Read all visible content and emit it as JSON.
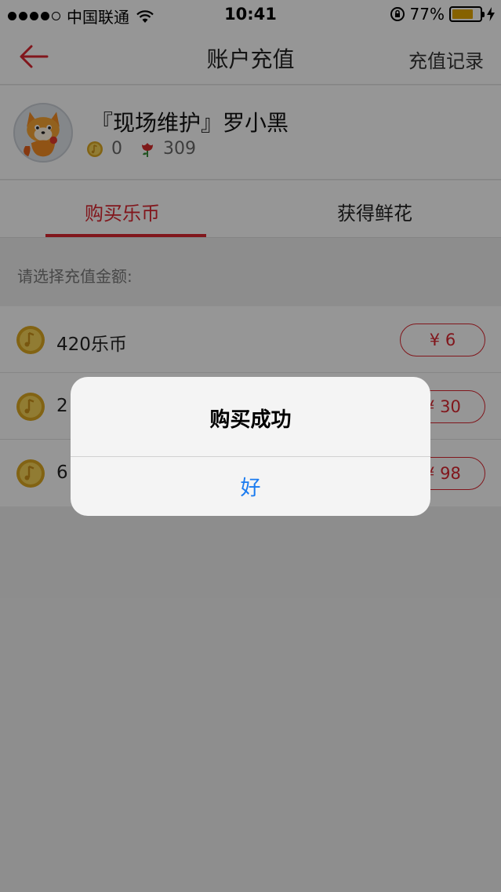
{
  "status_bar": {
    "carrier": "中国联通",
    "time": "10:41",
    "battery_percent_label": "77%",
    "battery_level": 0.77,
    "signal_bars": 4
  },
  "nav": {
    "title": "账户充值",
    "right_action": "充值记录"
  },
  "profile": {
    "username": "『现场维护』罗小黑",
    "coins": "0",
    "flowers": "309"
  },
  "tabs": [
    {
      "label": "购买乐币",
      "active": true
    },
    {
      "label": "获得鲜花",
      "active": false
    }
  ],
  "section_label": "请选择充值金额:",
  "packages": [
    {
      "name": "420乐币",
      "price": "¥ 6"
    },
    {
      "name": "2",
      "price": "¥ 30"
    },
    {
      "name": "6",
      "price": "¥ 98"
    }
  ],
  "alert": {
    "title": "购买成功",
    "ok_label": "好"
  },
  "colors": {
    "accent": "#d8262f",
    "link_blue": "#1a7bf0",
    "coin_gold": "#e6b830"
  }
}
